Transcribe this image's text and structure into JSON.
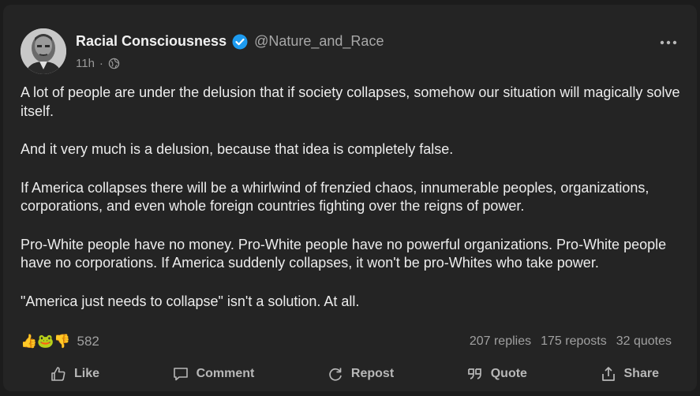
{
  "author": {
    "name": "Racial Consciousness",
    "handle": "@Nature_and_Race",
    "time": "11h",
    "separator": "·"
  },
  "post": {
    "paragraphs": [
      "A lot of people are under the delusion that if society collapses, somehow our situation will magically solve itself.",
      "And it very much is a delusion, because that idea is completely false.",
      "If America collapses there will be a whirlwind of frenzied chaos, innumerable peoples, organizations, corporations, and even whole foreign countries fighting over the reigns of power.",
      "Pro-White people have no money. Pro-White people have no powerful organizations. Pro-White people have no corporations. If America suddenly collapses, it won't be pro-Whites who take power.",
      "\"America just needs to collapse\" isn't a solution. At all."
    ]
  },
  "stats": {
    "reaction_emojis": [
      "👍",
      "🐸",
      "👎"
    ],
    "reaction_count": "582",
    "replies": "207 replies",
    "reposts": "175 reposts",
    "quotes": "32 quotes"
  },
  "actions": {
    "like": "Like",
    "comment": "Comment",
    "repost": "Repost",
    "quote": "Quote",
    "share": "Share"
  },
  "colors": {
    "background": "#1c1c1c",
    "card": "#242424",
    "verified": "#1d9bf0",
    "text": "#ececec",
    "muted": "#a0a0a0"
  },
  "icons": [
    "verified-badge-icon",
    "globe-icon",
    "more-options-icon",
    "like-icon",
    "comment-icon",
    "repost-icon",
    "quote-icon",
    "share-icon"
  ]
}
